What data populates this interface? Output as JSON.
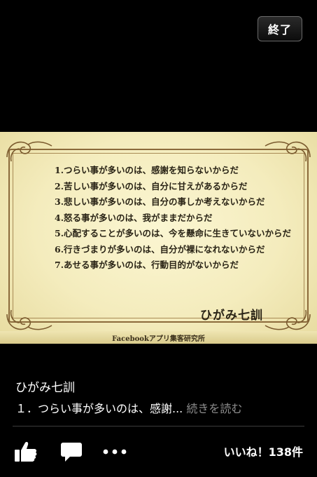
{
  "topbar": {
    "done_label": "終了"
  },
  "photo": {
    "items": [
      "1.つらい事が多いのは、感謝を知らないからだ",
      "2.苦しい事が多いのは、自分に甘えがあるからだ",
      "3.悲しい事が多いのは、自分の事しか考えないからだ",
      "4.怒る事が多いのは、我がままだからだ",
      "5.心配することが多いのは、今を懸命に生きていないからだ",
      "6.行きづまりが多いのは、自分が裸になれないからだ",
      "7.あせる事が多いのは、行動目的がないからだ"
    ],
    "title": "ひがみ七訓",
    "footer": "Facebookアプリ集客研究所"
  },
  "caption": {
    "title": "ひがみ七訓",
    "text": "１．つらい事が多いのは、感謝...",
    "more": "続きを読む"
  },
  "actions": {
    "like_icon": "thumbs-up-icon",
    "comment_icon": "comment-bubble-icon",
    "more_icon": "ellipsis-icon",
    "like_count": "いいね！138件"
  }
}
